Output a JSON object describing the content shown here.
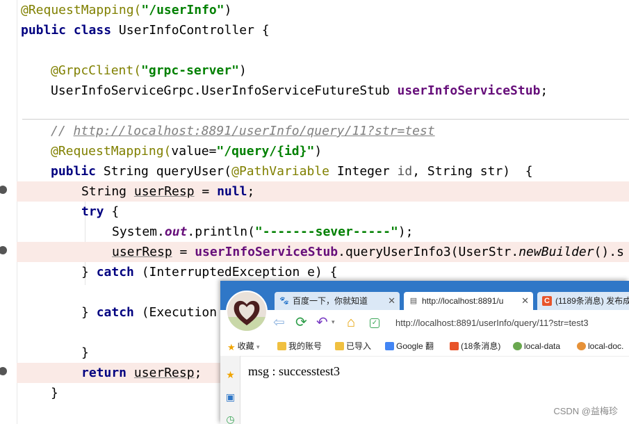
{
  "editor": {
    "lines": {
      "l1": {
        "ann": "@RequestMapping(",
        "str": "\"/userInfo\"",
        "end": ")"
      },
      "l2": {
        "kw1": "public",
        "kw2": "class",
        "rest": " UserInfoController {"
      },
      "l4": {
        "ann": "@GrpcClient(",
        "str": "\"grpc-server\"",
        "end": ")"
      },
      "l5": {
        "type": "UserInfoServiceGrpc.UserInfoServiceFutureStub ",
        "field": "userInfoServiceStub",
        "end": ";"
      },
      "l6": {
        "slashes": "// ",
        "link": "http://localhost:8891/userInfo/query/11?str=test"
      },
      "l7": {
        "ann": "@RequestMapping(",
        "plain": "value=",
        "str": "\"/query/{id}\"",
        "end": ")"
      },
      "l8": {
        "kw": "public",
        "a": " String queryUser(",
        "ann": "@PathVariable",
        "b": " Integer ",
        "param": "id",
        "c": ", String ",
        "param2": "str",
        "d": ")  {"
      },
      "l9": {
        "a": "String ",
        "var": "userResp",
        "b": " = ",
        "kw": "null",
        "c": ";"
      },
      "l10": {
        "kw": "try",
        "rest": " {"
      },
      "l11": {
        "a": "System.",
        "sf": "out",
        "b": ".println(",
        "str": "\"-------sever-----\"",
        "c": ");"
      },
      "l12": {
        "var": "userResp",
        "a": " = ",
        "field": "userInfoServiceStub",
        "b": ".queryUserInfo3(UserStr.",
        "ital": "newBuilder",
        "c": "().s"
      },
      "l13": {
        "a": "} ",
        "kw": "catch",
        "b": " (InterruptedException e) {"
      },
      "l15": {
        "a": "} ",
        "kw": "catch",
        "b": " (Execution"
      },
      "l17": {
        "a": "}"
      },
      "l18": {
        "kw": "return",
        "a": " ",
        "var": "userResp",
        "b": ";"
      },
      "l19": {
        "a": "}"
      }
    }
  },
  "browser": {
    "tabs": [
      {
        "icon": "baidu-paw-icon",
        "label": "百度一下，你就知道"
      },
      {
        "icon": "page-icon",
        "label": "http://localhost:8891/u"
      },
      {
        "icon": "csdn-icon",
        "label": "(1189条消息) 发布成"
      }
    ],
    "tab_close": "✕",
    "url": "http://localhost:8891/userInfo/query/11?str=test3",
    "bookmarks": [
      {
        "icon": "star-icon",
        "label": "收藏",
        "color": "#f0a400"
      },
      {
        "icon": "folder-icon",
        "label": "我的账号",
        "color": "#f0c040"
      },
      {
        "icon": "folder-icon",
        "label": "已导入",
        "color": "#f0c040"
      },
      {
        "icon": "google-icon",
        "label": "Google 翻",
        "color": "#4285f4"
      },
      {
        "icon": "csdn-icon",
        "label": "(18条消息)",
        "color": "#e8542a"
      },
      {
        "icon": "globe-icon",
        "label": "local-data",
        "color": "#6aa84f"
      },
      {
        "icon": "doc-icon",
        "label": "local-doc.",
        "color": "#e69138"
      }
    ],
    "content_text": "msg : successtest3"
  },
  "watermark": "CSDN @益梅珍",
  "colors": {
    "accent_tab_strip": "#2f77c7",
    "highlight_line": "#faeae6"
  }
}
